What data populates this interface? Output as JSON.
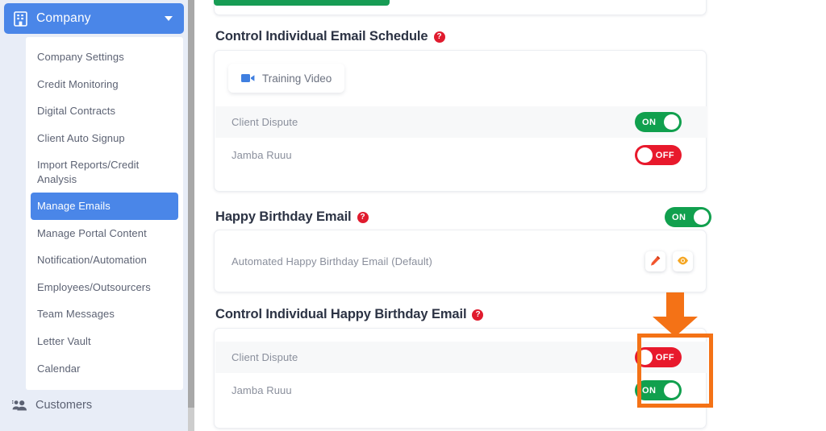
{
  "sidebar": {
    "company_button": {
      "label": "Company",
      "icon": "building-icon",
      "caret": "chevron-down-icon"
    },
    "submenu": [
      {
        "label": "Company Settings",
        "active": false
      },
      {
        "label": "Credit Monitoring",
        "active": false
      },
      {
        "label": "Digital Contracts",
        "active": false
      },
      {
        "label": "Client Auto Signup",
        "active": false
      },
      {
        "label": "Import Reports/Credit Analysis",
        "active": false
      },
      {
        "label": "Manage Emails",
        "active": true
      },
      {
        "label": "Manage Portal Content",
        "active": false
      },
      {
        "label": "Notification/Automation",
        "active": false
      },
      {
        "label": "Employees/Outsourcers",
        "active": false
      },
      {
        "label": "Team Messages",
        "active": false
      },
      {
        "label": "Letter Vault",
        "active": false
      },
      {
        "label": "Calendar",
        "active": false
      }
    ],
    "customers": {
      "label": "Customers",
      "icon": "people-icon"
    }
  },
  "main": {
    "sections": [
      {
        "title": "Control Individual Email Schedule",
        "help_icon": "question-mark-icon",
        "training_video": {
          "label": "Training Video",
          "icon": "video-camera-icon"
        },
        "rows": [
          {
            "label": "Client Dispute",
            "toggle": "ON"
          },
          {
            "label": "Jamba Ruuu",
            "toggle": "OFF"
          }
        ]
      },
      {
        "title": "Happy Birthday Email",
        "help_icon": "question-mark-icon",
        "header_toggle": "ON",
        "rows": [
          {
            "label": "Automated Happy Birthday Email (Default)",
            "actions": [
              "edit-icon",
              "preview-icon"
            ]
          }
        ]
      },
      {
        "title": "Control Individual Happy Birthday Email",
        "help_icon": "question-mark-icon",
        "rows": [
          {
            "label": "Client Dispute",
            "toggle": "OFF"
          },
          {
            "label": "Jamba Ruuu",
            "toggle": "ON"
          }
        ]
      }
    ]
  },
  "annotation": {
    "highlight_color": "#f47216",
    "arrow_icon": "down-arrow-annotation"
  },
  "colors": {
    "accent_blue": "#4a86e8",
    "toggle_on": "#11a04e",
    "toggle_off": "#e8192c",
    "help_red": "#e01b2e",
    "annotation_orange": "#f47216"
  }
}
